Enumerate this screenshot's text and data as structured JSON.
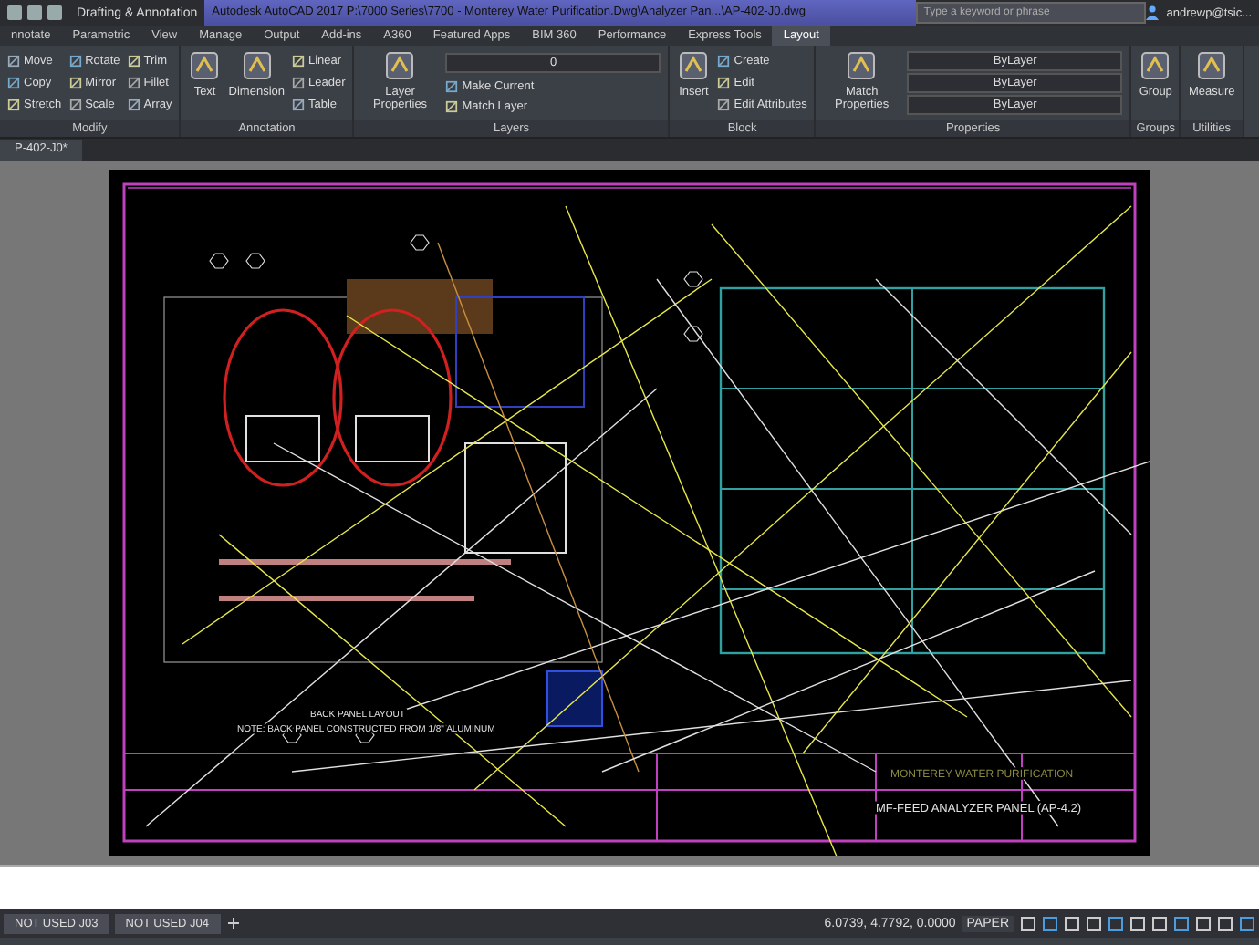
{
  "title_bar": {
    "workspace": "Drafting & Annotation",
    "title": "Autodesk AutoCAD 2017   P:\\7000 Series\\7700 - Monterey Water Purification.Dwg\\Analyzer Pan...\\AP-402-J0.dwg",
    "search": {
      "placeholder": "Type a keyword or phrase"
    },
    "user": "andrewp@tsic..."
  },
  "ribbon": {
    "tabs": [
      {
        "label": "nnotate",
        "selected": false
      },
      {
        "label": "Parametric",
        "selected": false
      },
      {
        "label": "View",
        "selected": false
      },
      {
        "label": "Manage",
        "selected": false
      },
      {
        "label": "Output",
        "selected": false
      },
      {
        "label": "Add-ins",
        "selected": false
      },
      {
        "label": "A360",
        "selected": false
      },
      {
        "label": "Featured Apps",
        "selected": false
      },
      {
        "label": "BIM 360",
        "selected": false
      },
      {
        "label": "Performance",
        "selected": false
      },
      {
        "label": "Express Tools",
        "selected": false
      },
      {
        "label": "Layout",
        "selected": true
      }
    ],
    "panels": [
      {
        "title": "Modify",
        "columns": [
          {
            "kind": "stack",
            "items": [
              "Move",
              "Copy",
              "Stretch"
            ]
          },
          {
            "kind": "stack",
            "items": [
              "Rotate",
              "Mirror",
              "Scale"
            ]
          },
          {
            "kind": "stack",
            "items": [
              "Trim",
              "Fillet",
              "Array"
            ]
          }
        ]
      },
      {
        "title": "Annotation",
        "columns": [
          {
            "kind": "large",
            "label": "Text"
          },
          {
            "kind": "large",
            "label": "Dimension"
          },
          {
            "kind": "stack",
            "items": [
              "Linear",
              "Leader",
              "Table"
            ]
          }
        ]
      },
      {
        "title": "Layers",
        "columns": [
          {
            "kind": "large",
            "label": "Layer Properties"
          },
          {
            "kind": "layer",
            "value": "0",
            "items": [
              "Make Current",
              "Match Layer"
            ]
          }
        ]
      },
      {
        "title": "Block",
        "columns": [
          {
            "kind": "large",
            "label": "Insert"
          },
          {
            "kind": "stack",
            "items": [
              "Create",
              "Edit",
              "Edit Attributes"
            ]
          }
        ]
      },
      {
        "title": "Properties",
        "columns": [
          {
            "kind": "large",
            "label": "Match Properties"
          },
          {
            "kind": "dropdowns",
            "items": [
              "ByLayer",
              "ByLayer",
              "ByLayer"
            ]
          }
        ]
      },
      {
        "title": "Groups",
        "columns": [
          {
            "kind": "large",
            "label": "Group"
          }
        ]
      },
      {
        "title": "Utilities",
        "columns": [
          {
            "kind": "large",
            "label": "Measure"
          }
        ]
      }
    ]
  },
  "document_tab": "P-402-J0*",
  "drawing": {
    "labels": [
      "BACK PANEL LAYOUT",
      "NOTE: BACK PANEL CONSTRUCTED FROM 1/8\" ALUMINUM",
      "MONTEREY WATER PURIFICATION",
      "MF-FEED ANALYZER PANEL (AP-4.2)"
    ]
  },
  "layout_tabs": [
    {
      "label": "NOT USED J03",
      "selected": false
    },
    {
      "label": "NOT USED J04",
      "selected": false
    }
  ],
  "status_bar": {
    "coordinates": "6.0739, 4.7792, 0.0000",
    "space": "PAPER"
  }
}
